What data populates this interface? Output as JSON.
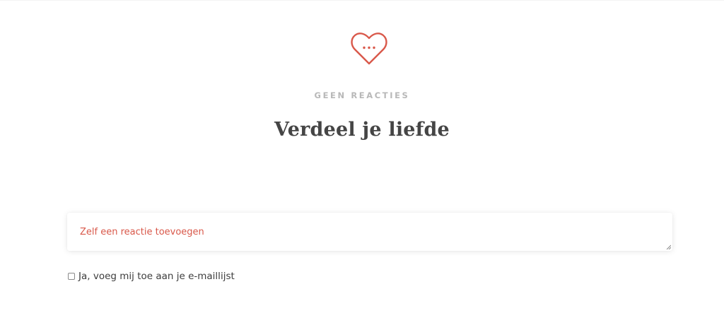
{
  "comments": {
    "icon": "heart-with-dots-icon",
    "count_label": "GEEN REACTIES",
    "heading": "Verdeel je liefde"
  },
  "form": {
    "comment_placeholder": "Zelf een reactie toevoegen",
    "comment_value": "",
    "newsletter_label": "Ja, voeg mij toe aan je e-maillijst",
    "newsletter_checked": false
  },
  "colors": {
    "accent": "#d9584a",
    "heading": "#454545",
    "muted": "#b8b8b8",
    "background": "#ffffff"
  }
}
